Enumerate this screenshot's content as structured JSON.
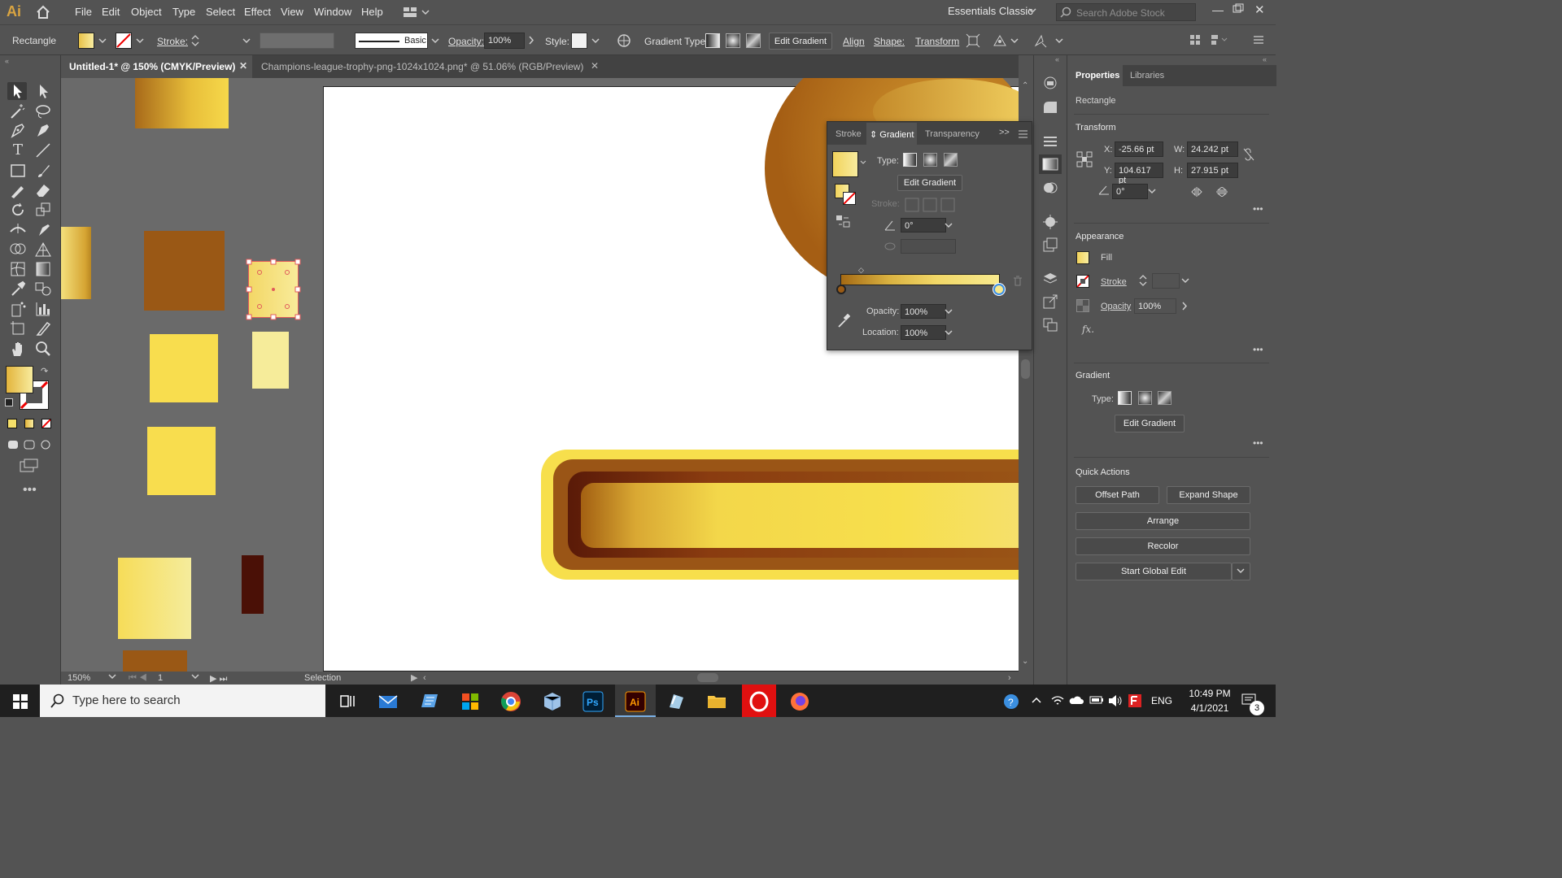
{
  "app": {
    "logo": "Ai",
    "workspace": "Essentials Classic",
    "search_placeholder": "Search Adobe Stock"
  },
  "menu": [
    "File",
    "Edit",
    "Object",
    "Type",
    "Select",
    "Effect",
    "View",
    "Window",
    "Help"
  ],
  "control": {
    "object": "Rectangle",
    "stroke_label": "Stroke:",
    "brush": "Basic",
    "opacity_label": "Opacity:",
    "opacity": "100%",
    "style_label": "Style:",
    "gradient_type_label": "Gradient Type:",
    "edit_gradient": "Edit Gradient",
    "align": "Align",
    "shape": "Shape:",
    "transform": "Transform"
  },
  "tabs": [
    {
      "label": "Untitled-1* @ 150% (CMYK/Preview)"
    },
    {
      "label": "Champions-league-trophy-png-1024x1024.png* @ 51.06% (RGB/Preview)"
    }
  ],
  "gradient_panel": {
    "tabs": [
      "Stroke",
      "Gradient",
      "Transparency"
    ],
    "type_label": "Type:",
    "edit_gradient": "Edit Gradient",
    "stroke_label": "Stroke:",
    "angle": "0°",
    "opacity_label": "Opacity:",
    "opacity": "100%",
    "location_label": "Location:",
    "location": "100%"
  },
  "properties": {
    "tabs": [
      "Properties",
      "Libraries"
    ],
    "object": "Rectangle",
    "transform_head": "Transform",
    "x_label": "X:",
    "x": "-25.66 pt",
    "y_label": "Y:",
    "y": "104.617 pt",
    "w_label": "W:",
    "w": "24.242 pt",
    "h_label": "H:",
    "h": "27.915 pt",
    "angle": "0°",
    "appearance_head": "Appearance",
    "fill": "Fill",
    "stroke": "Stroke",
    "opacity_label": "Opacity",
    "opacity": "100%",
    "fx": "fx.",
    "gradient_head": "Gradient",
    "type_label": "Type:",
    "edit_gradient": "Edit Gradient",
    "quick_actions_head": "Quick Actions",
    "offset_path": "Offset Path",
    "expand_shape": "Expand Shape",
    "arrange": "Arrange",
    "recolor": "Recolor",
    "start_global_edit": "Start Global Edit"
  },
  "status": {
    "zoom": "150%",
    "artboard": "1",
    "tool": "Selection"
  },
  "taskbar": {
    "search_placeholder": "Type here to search",
    "time": "10:49 PM",
    "date": "4/1/2021",
    "lang": "ENG",
    "notifications": "3"
  },
  "colors": {
    "gold_dark": "#9a5512",
    "gold_mid": "#d8a63a",
    "gold_light": "#f8e06a",
    "pale": "#f6ec9a",
    "brown": "#9a5a18",
    "dark_brown": "#4a1006"
  }
}
